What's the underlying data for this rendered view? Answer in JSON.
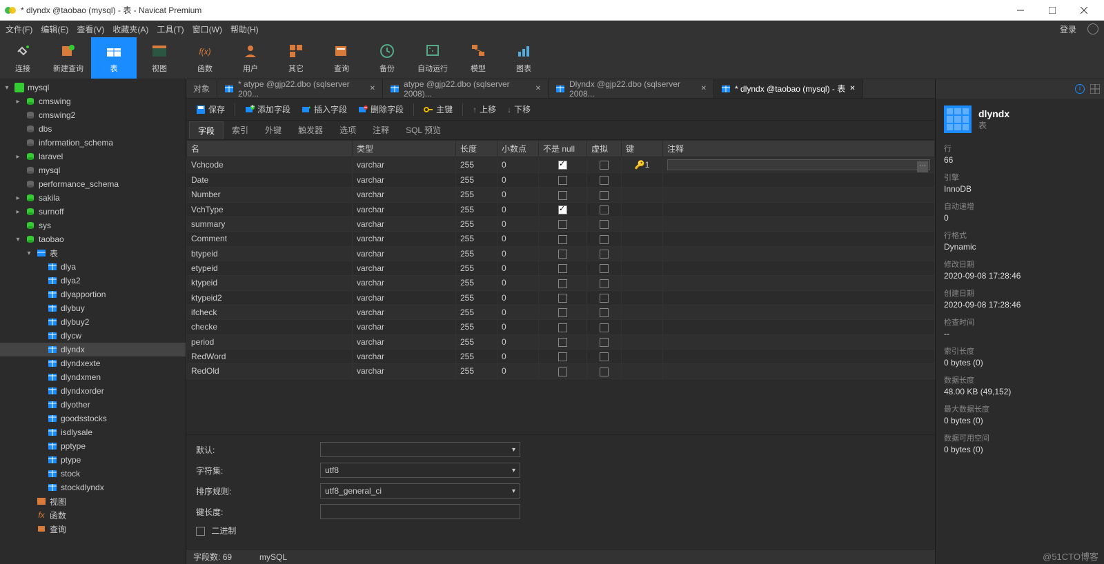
{
  "window": {
    "title": "* dlyndx @taobao (mysql) - 表 - Navicat Premium"
  },
  "menu": [
    "文件(F)",
    "编辑(E)",
    "查看(V)",
    "收藏夹(A)",
    "工具(T)",
    "窗口(W)",
    "帮助(H)"
  ],
  "menu_right": "登录",
  "toolbar": [
    {
      "label": "连接",
      "icon": "plug"
    },
    {
      "label": "新建查询",
      "icon": "newquery"
    },
    {
      "label": "表",
      "icon": "table",
      "active": true
    },
    {
      "label": "视图",
      "icon": "view"
    },
    {
      "label": "函数",
      "icon": "fx"
    },
    {
      "label": "用户",
      "icon": "user"
    },
    {
      "label": "其它",
      "icon": "other"
    },
    {
      "label": "查询",
      "icon": "query"
    },
    {
      "label": "备份",
      "icon": "backup"
    },
    {
      "label": "自动运行",
      "icon": "autorun"
    },
    {
      "label": "模型",
      "icon": "model"
    },
    {
      "label": "图表",
      "icon": "chart"
    }
  ],
  "tree": [
    {
      "depth": 0,
      "arrow": "▾",
      "icon": "conn-green",
      "label": "mysql"
    },
    {
      "depth": 1,
      "arrow": "▸",
      "icon": "db",
      "label": "cmswing"
    },
    {
      "depth": 1,
      "arrow": "",
      "icon": "db-dim",
      "label": "cmswing2"
    },
    {
      "depth": 1,
      "arrow": "",
      "icon": "db-dim",
      "label": "dbs"
    },
    {
      "depth": 1,
      "arrow": "",
      "icon": "db-dim",
      "label": "information_schema"
    },
    {
      "depth": 1,
      "arrow": "▸",
      "icon": "db",
      "label": "laravel"
    },
    {
      "depth": 1,
      "arrow": "",
      "icon": "db-dim",
      "label": "mysql"
    },
    {
      "depth": 1,
      "arrow": "",
      "icon": "db-dim",
      "label": "performance_schema"
    },
    {
      "depth": 1,
      "arrow": "▸",
      "icon": "db",
      "label": "sakila"
    },
    {
      "depth": 1,
      "arrow": "▸",
      "icon": "db",
      "label": "surnoff"
    },
    {
      "depth": 1,
      "arrow": "",
      "icon": "db",
      "label": "sys"
    },
    {
      "depth": 1,
      "arrow": "▾",
      "icon": "db",
      "label": "taobao"
    },
    {
      "depth": 2,
      "arrow": "▾",
      "icon": "tables",
      "label": "表"
    },
    {
      "depth": 3,
      "arrow": "",
      "icon": "tbl",
      "label": "dlya"
    },
    {
      "depth": 3,
      "arrow": "",
      "icon": "tbl",
      "label": "dlya2"
    },
    {
      "depth": 3,
      "arrow": "",
      "icon": "tbl",
      "label": "dlyapportion"
    },
    {
      "depth": 3,
      "arrow": "",
      "icon": "tbl",
      "label": "dlybuy"
    },
    {
      "depth": 3,
      "arrow": "",
      "icon": "tbl",
      "label": "dlybuy2"
    },
    {
      "depth": 3,
      "arrow": "",
      "icon": "tbl",
      "label": "dlycw"
    },
    {
      "depth": 3,
      "arrow": "",
      "icon": "tbl",
      "label": "dlyndx",
      "sel": true
    },
    {
      "depth": 3,
      "arrow": "",
      "icon": "tbl",
      "label": "dlyndxexte"
    },
    {
      "depth": 3,
      "arrow": "",
      "icon": "tbl",
      "label": "dlyndxmen"
    },
    {
      "depth": 3,
      "arrow": "",
      "icon": "tbl",
      "label": "dlyndxorder"
    },
    {
      "depth": 3,
      "arrow": "",
      "icon": "tbl",
      "label": "dlyother"
    },
    {
      "depth": 3,
      "arrow": "",
      "icon": "tbl",
      "label": "goodsstocks"
    },
    {
      "depth": 3,
      "arrow": "",
      "icon": "tbl",
      "label": "isdlysale"
    },
    {
      "depth": 3,
      "arrow": "",
      "icon": "tbl",
      "label": "pptype"
    },
    {
      "depth": 3,
      "arrow": "",
      "icon": "tbl",
      "label": "ptype"
    },
    {
      "depth": 3,
      "arrow": "",
      "icon": "tbl",
      "label": "stock"
    },
    {
      "depth": 3,
      "arrow": "",
      "icon": "tbl",
      "label": "stockdlyndx"
    },
    {
      "depth": 2,
      "arrow": "",
      "icon": "views",
      "label": "视图"
    },
    {
      "depth": 2,
      "arrow": "",
      "icon": "fx",
      "label": "函数"
    },
    {
      "depth": 2,
      "arrow": "",
      "icon": "query",
      "label": "查询"
    }
  ],
  "tabs": [
    {
      "label": "对象",
      "icon": "",
      "object": true
    },
    {
      "label": "* atype @gjp22.dbo (sqlserver 200...",
      "icon": "tbl"
    },
    {
      "label": "atype @gjp22.dbo (sqlserver 2008)...",
      "icon": "tbl"
    },
    {
      "label": "Dlyndx @gjp22.dbo (sqlserver 2008...",
      "icon": "tbl"
    },
    {
      "label": "* dlyndx @taobao (mysql) - 表",
      "icon": "tbl",
      "active": true
    }
  ],
  "ops": {
    "save": "保存",
    "add": "添加字段",
    "insert": "插入字段",
    "delete": "删除字段",
    "key": "主键",
    "up": "上移",
    "down": "下移"
  },
  "subtabs": [
    "字段",
    "索引",
    "外键",
    "触发器",
    "选项",
    "注释",
    "SQL 预览"
  ],
  "columns": [
    "名",
    "类型",
    "长度",
    "小数点",
    "不是 null",
    "虚拟",
    "键",
    "注释"
  ],
  "rows": [
    {
      "name": "Vchcode",
      "type": "varchar",
      "len": "255",
      "dec": "0",
      "nn": true,
      "v": false,
      "key": "1",
      "edit": true
    },
    {
      "name": "Date",
      "type": "varchar",
      "len": "255",
      "dec": "0",
      "nn": false,
      "v": false
    },
    {
      "name": "Number",
      "type": "varchar",
      "len": "255",
      "dec": "0",
      "nn": false,
      "v": false
    },
    {
      "name": "VchType",
      "type": "varchar",
      "len": "255",
      "dec": "0",
      "nn": true,
      "v": false
    },
    {
      "name": "summary",
      "type": "varchar",
      "len": "255",
      "dec": "0",
      "nn": false,
      "v": false
    },
    {
      "name": "Comment",
      "type": "varchar",
      "len": "255",
      "dec": "0",
      "nn": false,
      "v": false
    },
    {
      "name": "btypeid",
      "type": "varchar",
      "len": "255",
      "dec": "0",
      "nn": false,
      "v": false
    },
    {
      "name": "etypeid",
      "type": "varchar",
      "len": "255",
      "dec": "0",
      "nn": false,
      "v": false
    },
    {
      "name": "ktypeid",
      "type": "varchar",
      "len": "255",
      "dec": "0",
      "nn": false,
      "v": false
    },
    {
      "name": "ktypeid2",
      "type": "varchar",
      "len": "255",
      "dec": "0",
      "nn": false,
      "v": false
    },
    {
      "name": "ifcheck",
      "type": "varchar",
      "len": "255",
      "dec": "0",
      "nn": false,
      "v": false
    },
    {
      "name": "checke",
      "type": "varchar",
      "len": "255",
      "dec": "0",
      "nn": false,
      "v": false
    },
    {
      "name": "period",
      "type": "varchar",
      "len": "255",
      "dec": "0",
      "nn": false,
      "v": false
    },
    {
      "name": "RedWord",
      "type": "varchar",
      "len": "255",
      "dec": "0",
      "nn": false,
      "v": false
    },
    {
      "name": "RedOld",
      "type": "varchar",
      "len": "255",
      "dec": "0",
      "nn": false,
      "v": false
    }
  ],
  "form": {
    "default_label": "默认:",
    "default_val": "",
    "charset_label": "字符集:",
    "charset_val": "utf8",
    "collate_label": "排序规则:",
    "collate_val": "utf8_general_ci",
    "keylen_label": "键长度:",
    "keylen_val": "",
    "binary_label": "二进制"
  },
  "status": {
    "fields_label": "字段数:",
    "fields_val": "69",
    "engine": "mySQL"
  },
  "rpanel": {
    "title": "dlyndx",
    "sub": "表",
    "props": [
      {
        "l": "行",
        "v": "66"
      },
      {
        "l": "引擎",
        "v": "InnoDB"
      },
      {
        "l": "自动递增",
        "v": "0"
      },
      {
        "l": "行格式",
        "v": "Dynamic"
      },
      {
        "l": "修改日期",
        "v": "2020-09-08 17:28:46"
      },
      {
        "l": "创建日期",
        "v": "2020-09-08 17:28:46"
      },
      {
        "l": "检查时间",
        "v": "--"
      },
      {
        "l": "索引长度",
        "v": "0 bytes (0)"
      },
      {
        "l": "数据长度",
        "v": "48.00 KB (49,152)"
      },
      {
        "l": "最大数据长度",
        "v": "0 bytes (0)"
      },
      {
        "l": "数据可用空间",
        "v": "0 bytes (0)"
      }
    ]
  },
  "watermark": "@51CTO博客"
}
